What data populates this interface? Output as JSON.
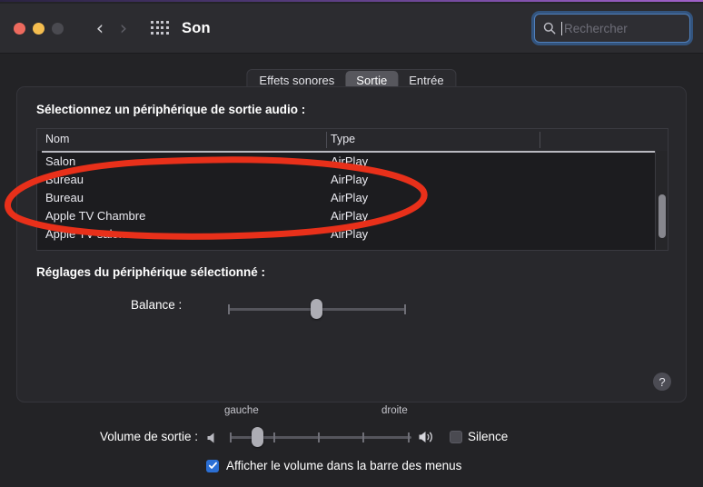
{
  "window": {
    "title": "Son",
    "traffic_lights": [
      "close-red",
      "minimize-yellow",
      "maximize-disabled"
    ],
    "nav_back": "‹",
    "nav_forward": "›",
    "grid_icon": "apps-grid-icon"
  },
  "search": {
    "placeholder": "Rechercher",
    "icon": "search-icon",
    "value": "",
    "focus_color": "#3a76c0"
  },
  "tabs": [
    {
      "label": "Effets sonores",
      "active": false
    },
    {
      "label": "Sortie",
      "active": true
    },
    {
      "label": "Entrée",
      "active": false
    }
  ],
  "panel": {
    "title": "Sélectionnez un périphérique de sortie audio :",
    "settings_title": "Réglages du périphérique sélectionné :",
    "help_icon": "?"
  },
  "table": {
    "columns": [
      "Nom",
      "Type"
    ],
    "rows": [
      {
        "name": "Salon",
        "type": "AirPlay"
      },
      {
        "name": "Bureau",
        "type": "AirPlay"
      },
      {
        "name": "Bureau",
        "type": "AirPlay"
      },
      {
        "name": "Apple TV Chambre",
        "type": "AirPlay"
      },
      {
        "name": "Apple TV salon",
        "type": "AirPlay"
      }
    ],
    "scrollbar": {
      "visible": true,
      "thumb_position_pct": 55
    }
  },
  "balance": {
    "label": "Balance :",
    "min_label": "gauche",
    "max_label": "droite",
    "value_pct": 50
  },
  "volume": {
    "label": "Volume de sortie :",
    "value_pct": 20,
    "speaker_min_icon": "speaker-low-icon",
    "speaker_max_icon": "speaker-high-icon",
    "mute_label": "Silence",
    "mute_checked": false
  },
  "menubar_option": {
    "label": "Afficher le volume dans la barre des menus",
    "checked": true,
    "accent_color": "#2b6fd4"
  },
  "annotation": {
    "type": "hand-drawn-ellipse",
    "color": "#e8301a",
    "targets": [
      "Bureau",
      "Bureau"
    ]
  }
}
